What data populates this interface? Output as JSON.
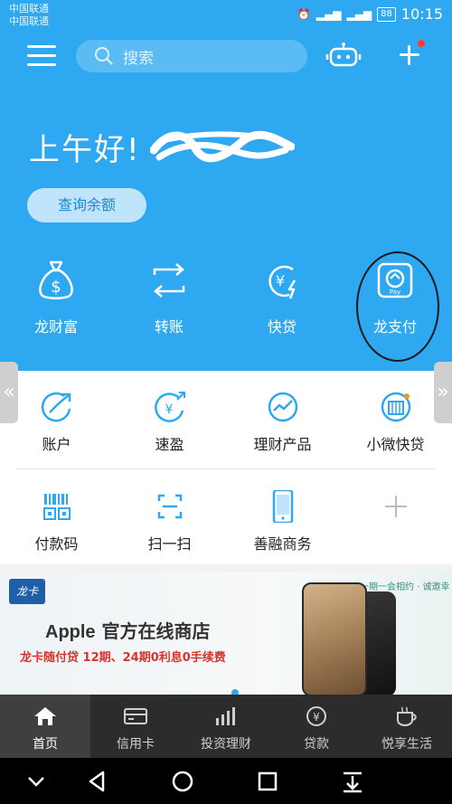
{
  "status_bar": {
    "carrier_1": "中国联通",
    "carrier_2": "中国联通",
    "battery": "88",
    "time": "10:15"
  },
  "top_bar": {
    "search_placeholder": "搜索"
  },
  "greeting": "上午好!",
  "balance_button": "查询余额",
  "quick_actions": [
    {
      "label": "龙财富",
      "icon": "money-bag-icon"
    },
    {
      "label": "转账",
      "icon": "transfer-icon"
    },
    {
      "label": "快贷",
      "icon": "fast-loan-icon"
    },
    {
      "label": "龙支付",
      "icon": "long-pay-icon"
    }
  ],
  "services_row1": [
    {
      "label": "账户",
      "icon": "account-trend-icon"
    },
    {
      "label": "速盈",
      "icon": "speed-profit-icon"
    },
    {
      "label": "理财产品",
      "icon": "wealth-product-icon"
    },
    {
      "label": "小微快贷",
      "icon": "small-business-loan-icon"
    }
  ],
  "services_row2": [
    {
      "label": "付款码",
      "icon": "payment-code-icon"
    },
    {
      "label": "扫一扫",
      "icon": "scan-icon"
    },
    {
      "label": "善融商务",
      "icon": "shanrong-commerce-icon"
    },
    {
      "label": "",
      "icon": "add-icon"
    }
  ],
  "banner": {
    "logo_text": "龙卡",
    "title_en": "Apple",
    "title_cn": " 官方在线商店",
    "subtitle": "龙卡随付贷  12期、24期0利息0手续费",
    "slogan": "一期一会相约 · 诚邀幸福永久"
  },
  "tabs": [
    {
      "label": "首页",
      "icon": "home-icon",
      "active": true
    },
    {
      "label": "信用卡",
      "icon": "credit-card-icon",
      "active": false
    },
    {
      "label": "投资理财",
      "icon": "investment-chart-icon",
      "active": false
    },
    {
      "label": "贷款",
      "icon": "loan-icon",
      "active": false
    },
    {
      "label": "悦享生活",
      "icon": "coffee-icon",
      "active": false
    }
  ],
  "colors": {
    "primary_blue": "#2ea8f0",
    "tabbar_bg": "#2c2c2c",
    "banner_red": "#d8342e"
  }
}
